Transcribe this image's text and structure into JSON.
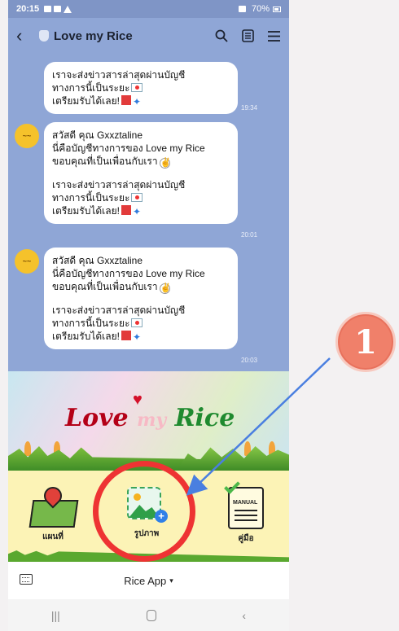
{
  "status_bar": {
    "time": "20:15",
    "battery": "70%"
  },
  "header": {
    "title": "Love my Rice"
  },
  "messages": [
    {
      "lines": [
        "เราจะส่งข่าวสารล่าสุดผ่านบัญชี",
        "ทางการนี้เป็นระยะ",
        "เตรียมรับได้เลย!"
      ],
      "time": "19:34"
    },
    {
      "sender_avatar_text": "~~",
      "lines": [
        "สวัสดี คุณ Gxxztaline",
        "นี่คือบัญชีทางการของ Love my Rice",
        "ขอบคุณที่เป็นเพื่อนกับเรา",
        "",
        "เราจะส่งข่าวสารล่าสุดผ่านบัญชี",
        "ทางการนี้เป็นระยะ",
        "เตรียมรับได้เลย!"
      ],
      "time": "20:01"
    },
    {
      "sender_avatar_text": "~~",
      "lines": [
        "สวัสดี คุณ Gxxztaline",
        "นี่คือบัญชีทางการของ Love my Rice",
        "ขอบคุณที่เป็นเพื่อนกับเรา",
        "",
        "เราจะส่งข่าวสารล่าสุดผ่านบัญชี",
        "ทางการนี้เป็นระยะ",
        "เตรียมรับได้เลย!"
      ],
      "time": "20:03"
    }
  ],
  "banner": {
    "logo_love": "Love",
    "logo_my": "my",
    "logo_rice": "Rice"
  },
  "rich_menu": {
    "map_label": "แผนที่",
    "image_label": "รูปภาพ",
    "manual_label": "คู่มือ",
    "manual_icon_text": "MANUAL"
  },
  "menu_bar": {
    "label": "Rice App"
  },
  "annotation": {
    "step_number": "1",
    "highlight_color": "#e33333",
    "arrow_color": "#4a7fe0"
  },
  "icons": [
    "back-icon",
    "search-icon",
    "notes-icon",
    "menu-icon",
    "map-icon",
    "image-icon",
    "manual-icon",
    "keyboard-icon"
  ]
}
